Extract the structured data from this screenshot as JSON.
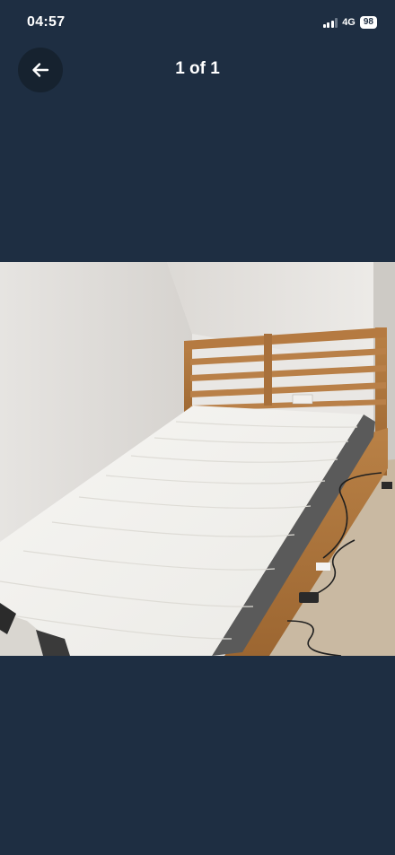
{
  "status_bar": {
    "time": "04:57",
    "network": "4G",
    "battery": "98"
  },
  "header": {
    "counter": "1 of 1"
  },
  "icons": {
    "back": "arrow-left-icon",
    "signal": "signal-bars-icon"
  },
  "photo": {
    "subject": "bed-photo"
  },
  "colors": {
    "background": "#1e2e42",
    "back_button": "#16222f",
    "text": "#ffffff"
  }
}
